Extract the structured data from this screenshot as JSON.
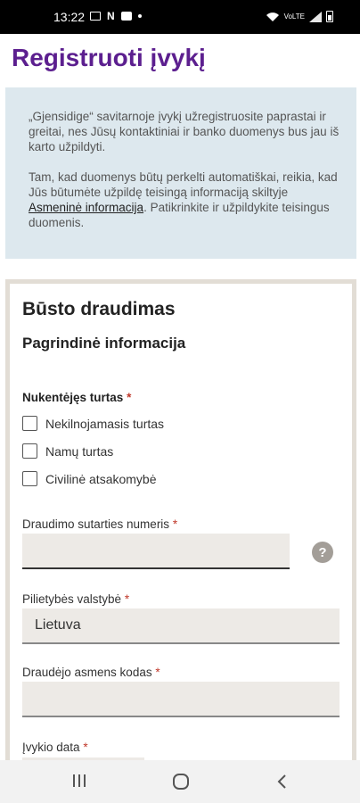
{
  "status_bar": {
    "time": "13:22",
    "notification_icons": [
      "gallery-icon",
      "n-icon",
      "chat-icon",
      "dot-icon"
    ],
    "right_icons": [
      "wifi-icon",
      "volte-icon",
      "signal-icon",
      "battery-icon"
    ],
    "volte_text": "VoLTE"
  },
  "page": {
    "title": "Registruoti įvykį"
  },
  "info_box": {
    "paragraph1": "„Gjensidige“ savitarnoje įvykį užregistruosite paprastai ir greitai, nes Jūsų kontaktiniai ir banko duomenys bus jau iš karto užpildyti.",
    "paragraph2_before": "Tam, kad duomenys būtų perkelti automatiškai, reikia, kad Jūs būtumėte užpildę teisingą informaciją skiltyje ",
    "paragraph2_link": "Asmeninė informacija",
    "paragraph2_after": ". Patikrinkite ir užpildykite teisingus duomenis."
  },
  "form": {
    "title": "Būsto draudimas",
    "subtitle": "Pagrindinė informacija",
    "required_mark": "*",
    "damaged_property": {
      "label": "Nukentėjęs turtas",
      "options": [
        {
          "label": "Nekilnojamasis turtas",
          "checked": false
        },
        {
          "label": "Namų turtas",
          "checked": false
        },
        {
          "label": "Civilinė atsakomybė",
          "checked": false
        }
      ]
    },
    "contract_number": {
      "label": "Draudimo sutarties numeris",
      "value": ""
    },
    "help_icon_glyph": "?",
    "citizenship": {
      "label": "Pilietybės valstybė",
      "value": "Lietuva"
    },
    "insured_code": {
      "label": "Draudėjo asmens kodas",
      "value": ""
    },
    "event_date": {
      "label": "Įvykio data",
      "value": ""
    }
  },
  "nav_bar": {
    "items": [
      "recents-icon",
      "home-icon",
      "back-icon"
    ]
  },
  "colors": {
    "title_purple": "#5c1f8f",
    "info_bg": "#dde8ee",
    "input_bg": "#edeae6",
    "card_border": "#e2ddd5",
    "required_red": "#c0392b"
  }
}
